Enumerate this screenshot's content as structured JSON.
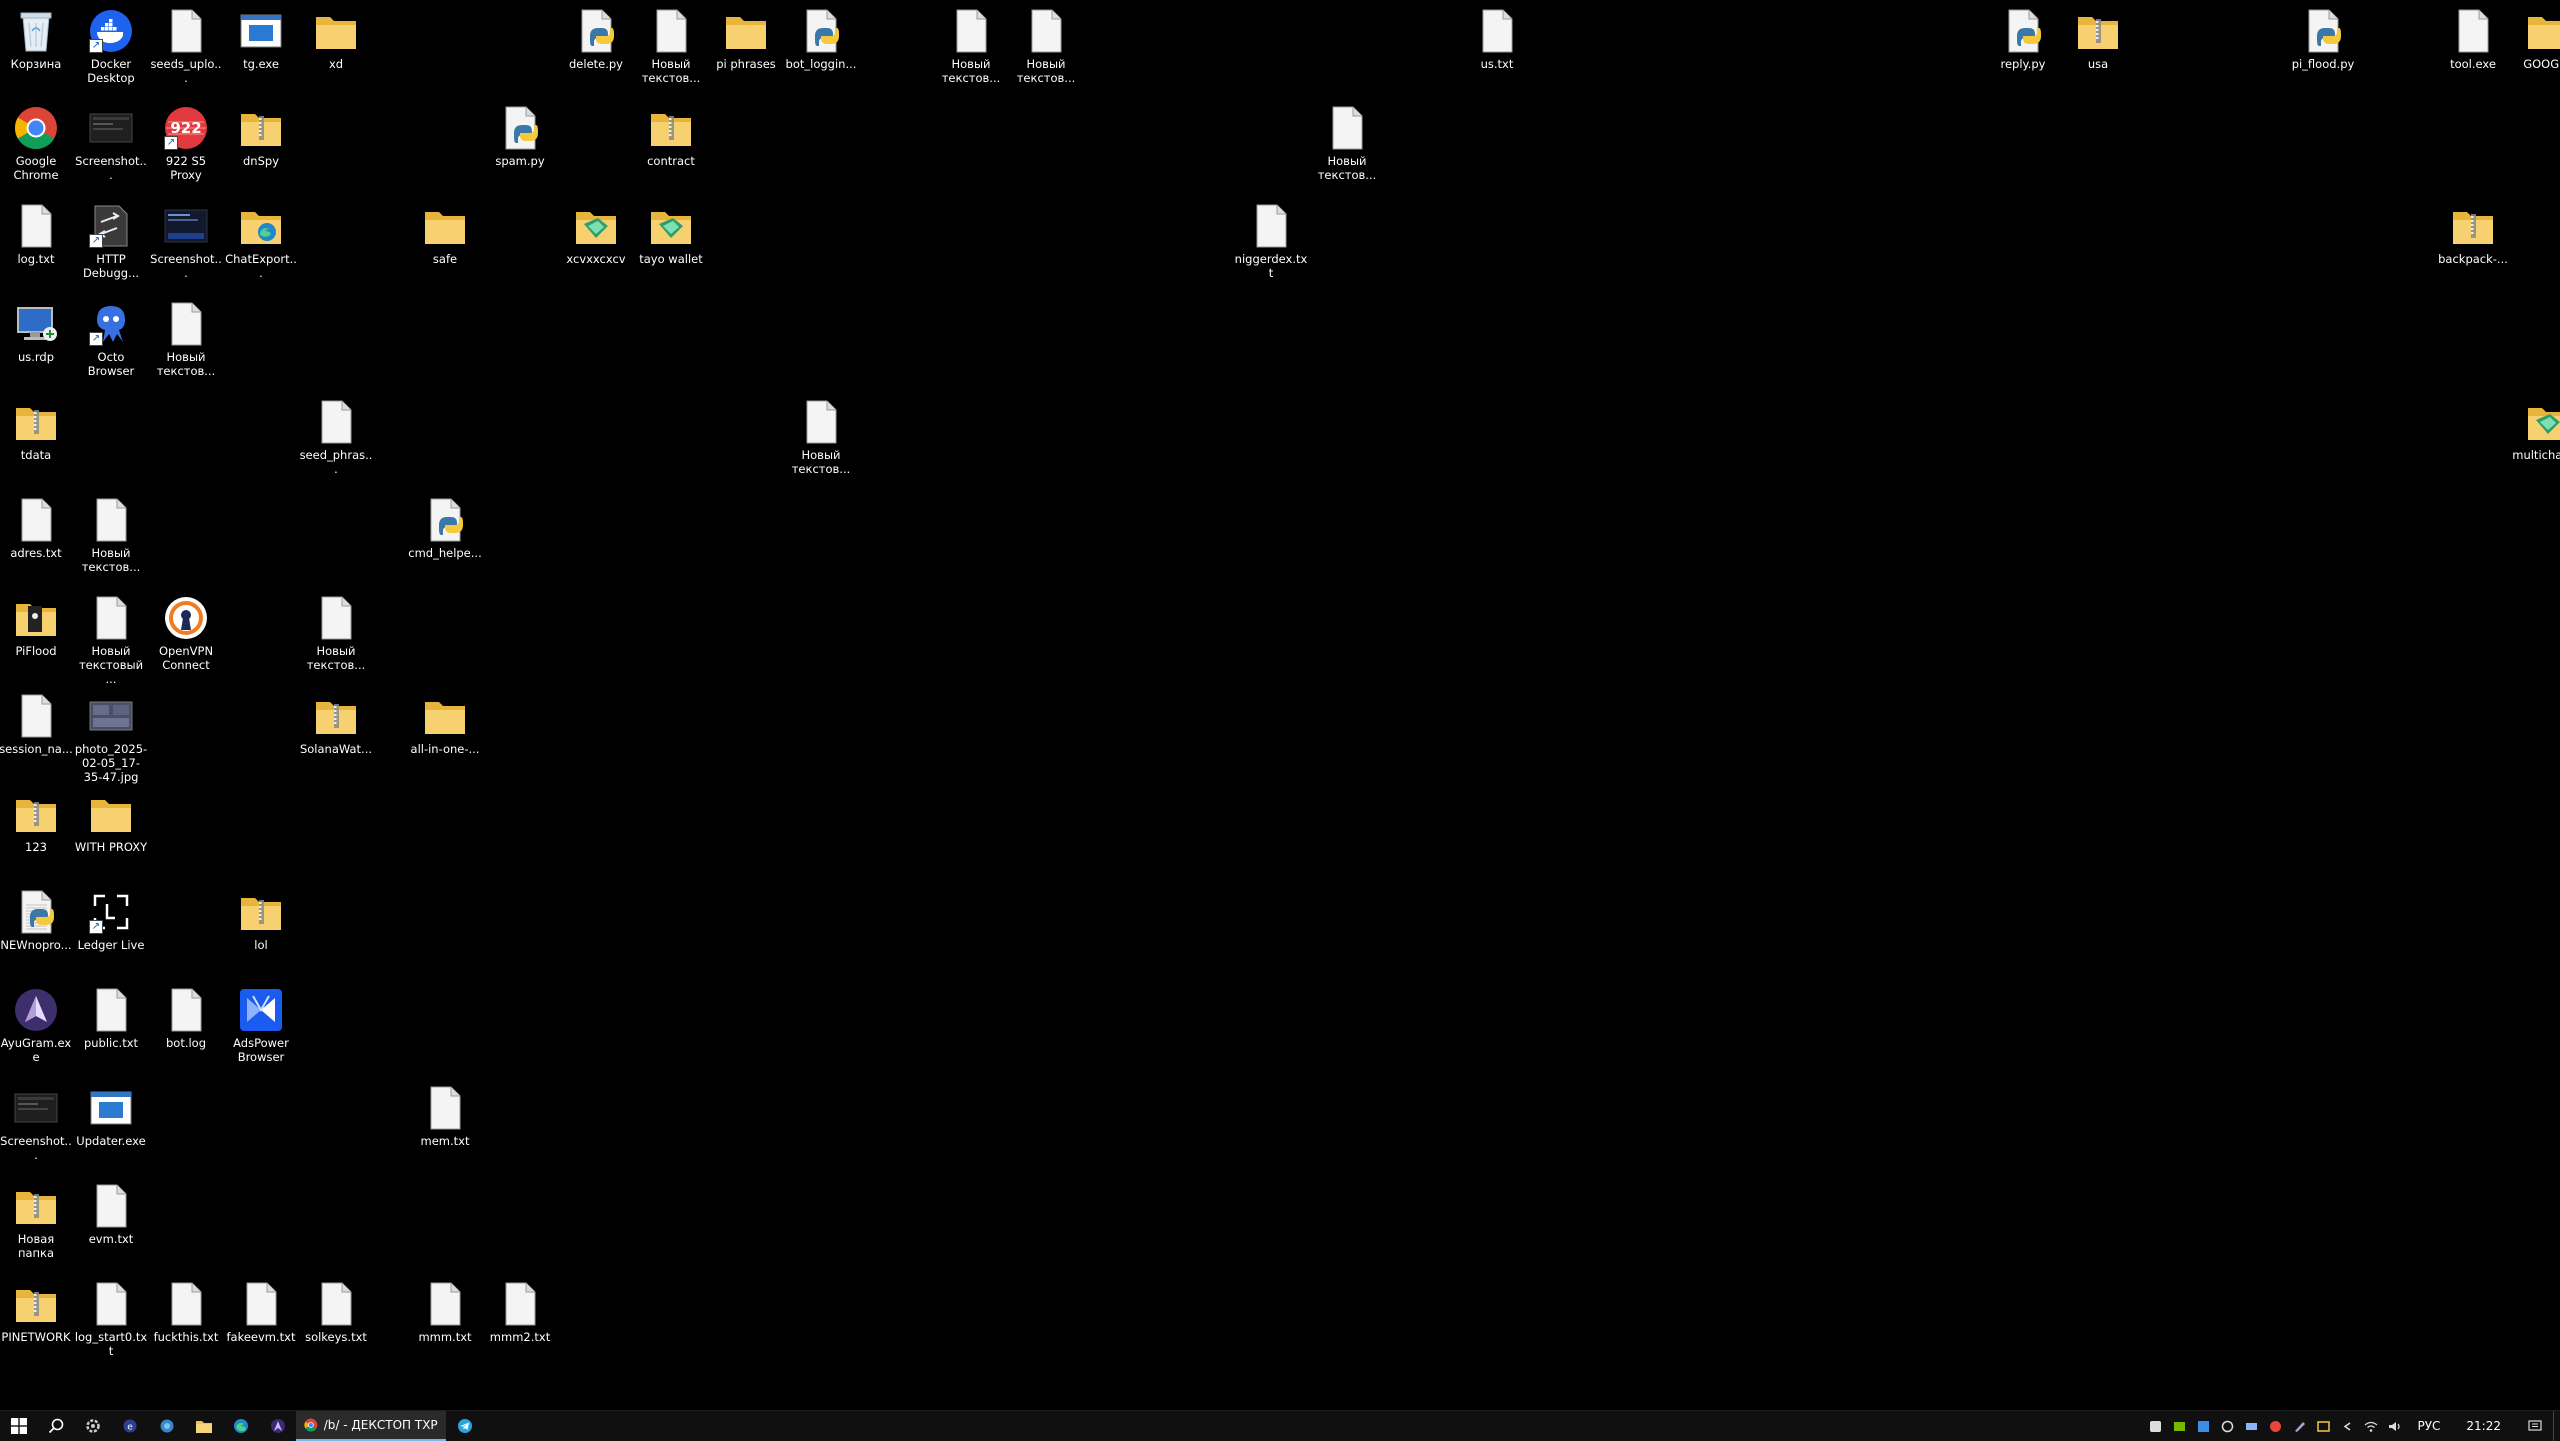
{
  "desktop": {
    "icons": [
      {
        "label": "Корзина",
        "type": "recycle",
        "col": 0,
        "row": 0
      },
      {
        "label": "Docker Desktop",
        "type": "docker",
        "col": 1,
        "row": 0,
        "shortcut": true
      },
      {
        "label": "seeds_uplo...",
        "type": "file",
        "col": 2,
        "row": 0
      },
      {
        "label": "tg.exe",
        "type": "exe",
        "col": 3,
        "row": 0
      },
      {
        "label": "xd",
        "type": "folder",
        "col": 4,
        "row": 0
      },
      {
        "label": "delete.py",
        "type": "python",
        "col": 7.45,
        "row": 0
      },
      {
        "label": "Новый текстов...",
        "type": "file",
        "col": 8.45,
        "row": 0
      },
      {
        "label": "pi phrases",
        "type": "folder",
        "col": 9.45,
        "row": 0
      },
      {
        "label": "bot_loggin...",
        "type": "python",
        "col": 10.45,
        "row": 0
      },
      {
        "label": "Новый текстов...",
        "type": "file",
        "col": 12.45,
        "row": 0
      },
      {
        "label": "Новый текстов...",
        "type": "file",
        "col": 13.45,
        "row": 0
      },
      {
        "label": "us.txt",
        "type": "file",
        "col": 19.45,
        "row": 0
      },
      {
        "label": "reply.py",
        "type": "python",
        "col": 26.45,
        "row": 0
      },
      {
        "label": "usa",
        "type": "folder-zip",
        "col": 27.45,
        "row": 0
      },
      {
        "label": "pi_flood.py",
        "type": "python",
        "col": 30.45,
        "row": 0
      },
      {
        "label": "tool.exe",
        "type": "blank",
        "col": 32.45,
        "row": 0
      },
      {
        "label": "GOOGLE",
        "type": "folder",
        "col": 33.45,
        "row": 0
      },
      {
        "label": "Google Chrome",
        "type": "chrome",
        "col": 0,
        "row": 1
      },
      {
        "label": "Screenshot...",
        "type": "screenshot",
        "col": 1,
        "row": 1
      },
      {
        "label": "922 S5 Proxy",
        "type": "proxy922",
        "col": 2,
        "row": 1,
        "shortcut": true
      },
      {
        "label": "dnSpy",
        "type": "folder-zip",
        "col": 3,
        "row": 1
      },
      {
        "label": "spam.py",
        "type": "python",
        "col": 6.45,
        "row": 1
      },
      {
        "label": "contract",
        "type": "folder-zip",
        "col": 8.45,
        "row": 1
      },
      {
        "label": "Новый текстов...",
        "type": "file",
        "col": 17.45,
        "row": 1
      },
      {
        "label": "log.txt",
        "type": "file",
        "col": 0,
        "row": 2
      },
      {
        "label": "HTTP Debugg...",
        "type": "http",
        "col": 1,
        "row": 2,
        "shortcut": true
      },
      {
        "label": "Screenshot...",
        "type": "screenshot2",
        "col": 2,
        "row": 2
      },
      {
        "label": "ChatExport...",
        "type": "folder-edge",
        "col": 3,
        "row": 2
      },
      {
        "label": "safe",
        "type": "folder",
        "col": 5.45,
        "row": 2
      },
      {
        "label": "xcvxxcxcv",
        "type": "folder-green",
        "col": 7.45,
        "row": 2
      },
      {
        "label": "tayo wallet",
        "type": "folder-green",
        "col": 8.45,
        "row": 2
      },
      {
        "label": "niggerdex.txt",
        "type": "file",
        "col": 16.45,
        "row": 2
      },
      {
        "label": "backpack-...",
        "type": "folder-zip",
        "col": 32.45,
        "row": 2
      },
      {
        "label": "us.rdp",
        "type": "rdp",
        "col": 0,
        "row": 3
      },
      {
        "label": "Octo Browser",
        "type": "octo",
        "col": 1,
        "row": 3,
        "shortcut": true
      },
      {
        "label": "Новый текстов...",
        "type": "file",
        "col": 2,
        "row": 3
      },
      {
        "label": "tdata",
        "type": "folder-zip",
        "col": 0,
        "row": 4
      },
      {
        "label": "seed_phras...",
        "type": "file",
        "col": 4,
        "row": 4
      },
      {
        "label": "Новый текстов...",
        "type": "file",
        "col": 10.45,
        "row": 4
      },
      {
        "label": "multichain...",
        "type": "folder-green",
        "col": 33.45,
        "row": 4
      },
      {
        "label": "adres.txt",
        "type": "file",
        "col": 0,
        "row": 5
      },
      {
        "label": "Новый текстов...",
        "type": "file",
        "col": 1,
        "row": 5
      },
      {
        "label": "cmd_helpe...",
        "type": "python",
        "col": 5.45,
        "row": 5
      },
      {
        "label": "PiFlood",
        "type": "folder-dark",
        "col": 0,
        "row": 6
      },
      {
        "label": "Новый текстовый ...",
        "type": "file",
        "col": 1,
        "row": 6
      },
      {
        "label": "OpenVPN Connect",
        "type": "openvpn",
        "col": 2,
        "row": 6
      },
      {
        "label": "Новый текстов...",
        "type": "file",
        "col": 4,
        "row": 6
      },
      {
        "label": "session_na...",
        "type": "blank",
        "col": 0,
        "row": 7
      },
      {
        "label": "photo_2025-02-05_17-35-47.jpg",
        "type": "photo",
        "col": 1,
        "row": 7
      },
      {
        "label": "SolanaWat...",
        "type": "folder-zip",
        "col": 4,
        "row": 7
      },
      {
        "label": "all-in-one-...",
        "type": "folder",
        "col": 5.45,
        "row": 7
      },
      {
        "label": "123",
        "type": "folder-zip",
        "col": 0,
        "row": 8
      },
      {
        "label": "WITH PROXY",
        "type": "folder",
        "col": 1,
        "row": 8
      },
      {
        "label": "NEWnopro...",
        "type": "python-folder",
        "col": 0,
        "row": 9
      },
      {
        "label": "Ledger Live",
        "type": "ledger",
        "col": 1,
        "row": 9,
        "shortcut": true
      },
      {
        "label": "lol",
        "type": "folder-zip",
        "col": 3,
        "row": 9
      },
      {
        "label": "AyuGram.exe",
        "type": "ayugram",
        "col": 0,
        "row": 10
      },
      {
        "label": "public.txt",
        "type": "file",
        "col": 1,
        "row": 10
      },
      {
        "label": "bot.log",
        "type": "file",
        "col": 2,
        "row": 10
      },
      {
        "label": "AdsPower Browser",
        "type": "adspower",
        "col": 3,
        "row": 10
      },
      {
        "label": "Screenshot...",
        "type": "screenshot",
        "col": 0,
        "row": 11
      },
      {
        "label": "Updater.exe",
        "type": "exe",
        "col": 1,
        "row": 11
      },
      {
        "label": "mem.txt",
        "type": "file",
        "col": 5.45,
        "row": 11
      },
      {
        "label": "Новая папка",
        "type": "folder-zip",
        "col": 0,
        "row": 12
      },
      {
        "label": "evm.txt",
        "type": "file",
        "col": 1,
        "row": 12
      },
      {
        "label": "PINETWORK",
        "type": "folder-zip",
        "col": 0,
        "row": 13
      },
      {
        "label": "log_start0.txt",
        "type": "file",
        "col": 1,
        "row": 13
      },
      {
        "label": "fuckthis.txt",
        "type": "file",
        "col": 2,
        "row": 13
      },
      {
        "label": "fakeevm.txt",
        "type": "file",
        "col": 3,
        "row": 13
      },
      {
        "label": "solkeys.txt",
        "type": "file",
        "col": 4,
        "row": 13
      },
      {
        "label": "mmm.txt",
        "type": "file",
        "col": 5.45,
        "row": 13
      },
      {
        "label": "mmm2.txt",
        "type": "file",
        "col": 6.45,
        "row": 13
      }
    ]
  },
  "taskbar": {
    "start_icon": "windows-start-icon",
    "pinned": [
      {
        "name": "search-icon"
      },
      {
        "name": "settings-icon"
      },
      {
        "name": "app-icon"
      },
      {
        "name": "app2-icon"
      },
      {
        "name": "file-explorer-icon"
      },
      {
        "name": "edge-icon"
      },
      {
        "name": "app3-icon"
      }
    ],
    "active_app_label": "/b/ - ДЕКСТОП ТХРЕ...",
    "telegram_icon": "telegram-icon",
    "tray": {
      "language": "РУС",
      "time": "21:22"
    }
  }
}
